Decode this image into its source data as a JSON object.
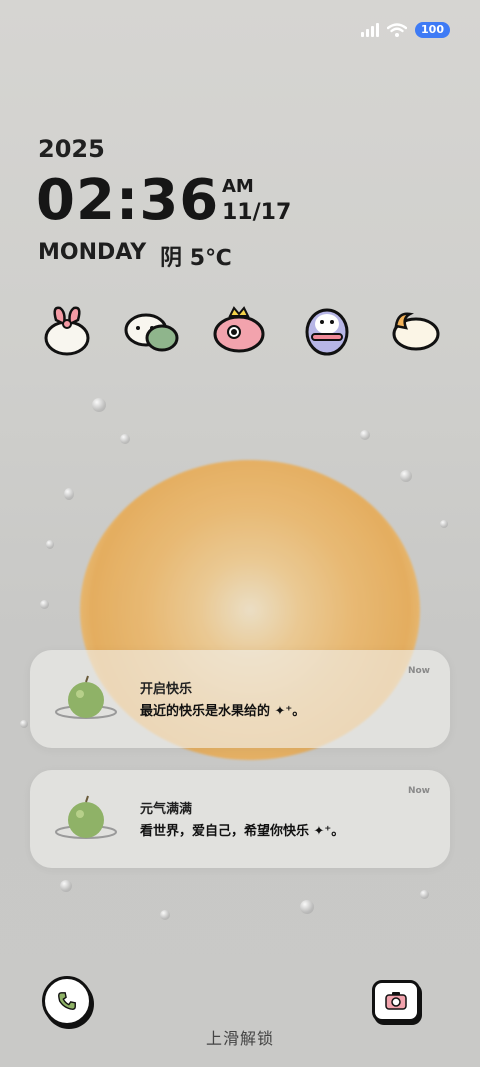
{
  "status_bar": {
    "battery": "100"
  },
  "clock": {
    "year": "2025",
    "time": "02:36",
    "ampm": "AM",
    "date": "11/17",
    "weekday": "MONDAY",
    "weather": "阴 5℃"
  },
  "widgets": [
    {
      "icon": "bunny-icon"
    },
    {
      "icon": "hamster-pair-icon"
    },
    {
      "icon": "pink-bird-icon"
    },
    {
      "icon": "penguin-icon"
    },
    {
      "icon": "moon-cloud-icon"
    }
  ],
  "notifications": [
    {
      "title": "开启快乐",
      "body": "最近的快乐是水果给的 ✦⁺。",
      "time": "Now"
    },
    {
      "title": "元气满满",
      "body": "看世界，爱自己，希望你快乐 ✦⁺。",
      "time": "Now"
    }
  ],
  "bottom": {
    "unlock_hint": "上滑解锁"
  },
  "colors": {
    "battery": "#3f7bf5",
    "apple": "#8fb267",
    "orange": "#eeb766"
  }
}
